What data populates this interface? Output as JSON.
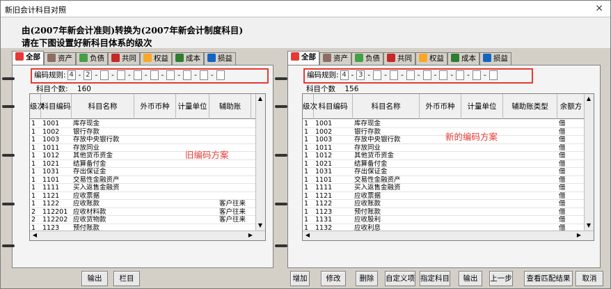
{
  "window": {
    "title": "新旧会计科目对照",
    "close": "×"
  },
  "header": {
    "line1": "由(2007年新会计准则)转换为(2007年新会计制度科目)",
    "line2": "请在下图设置好新科目体系的级次"
  },
  "left": {
    "tabs": [
      "全部",
      "资产",
      "负债",
      "共同",
      "权益",
      "成本",
      "损益"
    ],
    "encode_label": "编码规则:",
    "encode_values": [
      "4",
      "2",
      "",
      "",
      "",
      "",
      "",
      "",
      "",
      ""
    ],
    "count_label": "科目个数:",
    "count": "160",
    "columns": [
      "级次",
      "科目编码",
      "科目名称",
      "外币币种",
      "计量单位",
      "辅助账"
    ],
    "rows": [
      [
        "1",
        "1001",
        "库存现金",
        ""
      ],
      [
        "1",
        "1002",
        "银行存款",
        ""
      ],
      [
        "1",
        "1003",
        "存放中央银行款",
        ""
      ],
      [
        "1",
        "1011",
        "存放同业",
        ""
      ],
      [
        "1",
        "1012",
        "其他货币资金",
        ""
      ],
      [
        "1",
        "1021",
        "结算备付金",
        ""
      ],
      [
        "1",
        "1031",
        "存出保证金",
        ""
      ],
      [
        "1",
        "1101",
        "交易性金融资产",
        ""
      ],
      [
        "1",
        "1111",
        "买入返售金融资",
        ""
      ],
      [
        "1",
        "1121",
        "应收票据",
        ""
      ],
      [
        "1",
        "1122",
        "应收账款",
        "客户往来"
      ],
      [
        "2",
        "112201",
        "  应收材料款",
        "客户往来"
      ],
      [
        "2",
        "112202",
        "  应收货物款",
        "客户往来"
      ],
      [
        "1",
        "1123",
        "预付账款",
        ""
      ]
    ],
    "annotation": "旧编码方案"
  },
  "right": {
    "tabs": [
      "全部",
      "资产",
      "负债",
      "共同",
      "权益",
      "成本",
      "损益"
    ],
    "encode_label": "编码规则:",
    "encode_values": [
      "4",
      "3",
      "",
      "",
      "",
      "",
      "",
      "",
      "",
      ""
    ],
    "count_label": "科目个数",
    "count": "156",
    "columns": [
      "级次",
      "科目编码",
      "科目名称",
      "外币币种",
      "计量单位",
      "辅助账类型",
      "余额方"
    ],
    "rows": [
      [
        "1",
        "1001",
        "库存现金",
        "借"
      ],
      [
        "1",
        "1002",
        "银行存款",
        "借"
      ],
      [
        "1",
        "1003",
        "存放中央银行款",
        "借"
      ],
      [
        "1",
        "1011",
        "存放同业",
        "借"
      ],
      [
        "1",
        "1012",
        "其他货币资金",
        "借"
      ],
      [
        "1",
        "1021",
        "结算备付金",
        "借"
      ],
      [
        "1",
        "1031",
        "存出保证金",
        "借"
      ],
      [
        "1",
        "1101",
        "交易性金融资产",
        "借"
      ],
      [
        "1",
        "1111",
        "买入返售金融资",
        "借"
      ],
      [
        "1",
        "1121",
        "应收票据",
        "借"
      ],
      [
        "1",
        "1122",
        "应收账款",
        "借"
      ],
      [
        "1",
        "1123",
        "预付账款",
        "借"
      ],
      [
        "1",
        "1131",
        "应收股利",
        "借"
      ],
      [
        "1",
        "1132",
        "应收利息",
        "借"
      ]
    ],
    "annotation": "新的编码方案"
  },
  "buttons_left": [
    "输出",
    "栏目"
  ],
  "buttons_right": [
    "增加",
    "修改",
    "删除",
    "自定义项",
    "指定科目",
    "输出",
    "上一步",
    "查看匹配结果",
    "取消"
  ],
  "tab_colors": [
    "#e53935",
    "#8d6e63",
    "#43a047",
    "#c62828",
    "#f9a825",
    "#2e7d32",
    "#1565c0"
  ]
}
